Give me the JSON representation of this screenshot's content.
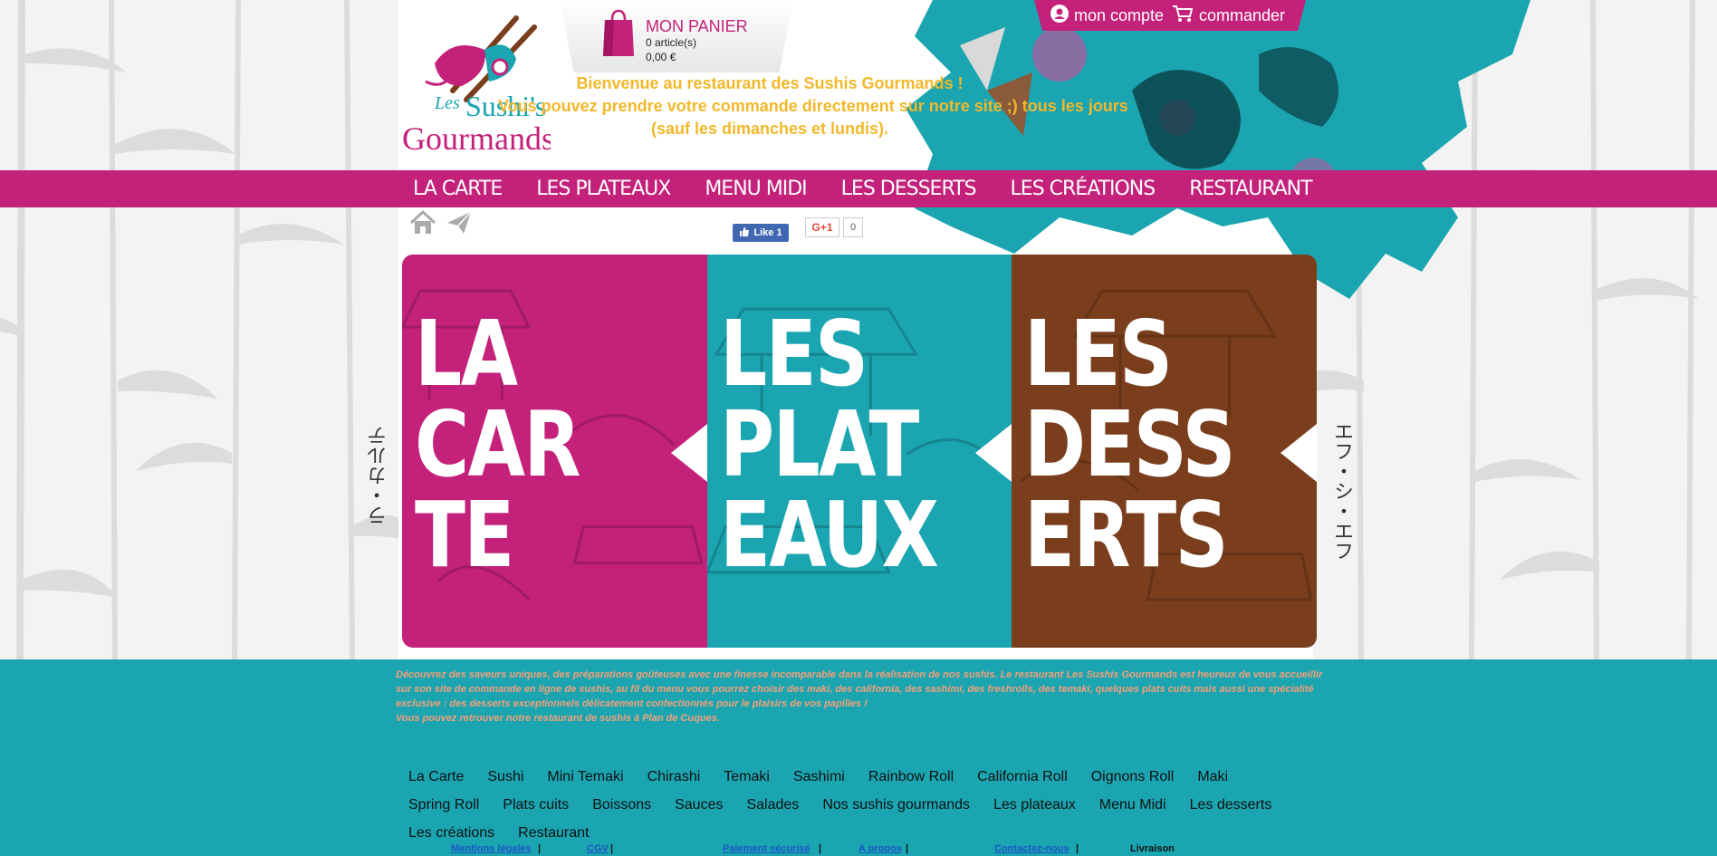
{
  "header": {
    "logo_text": "Les Sushi's Gourmands",
    "cart": {
      "title": "MON PANIER",
      "count": "0 article(s)",
      "total": "0,00 €"
    },
    "account": {
      "my_account": "mon compte",
      "order": "commander"
    },
    "welcome": {
      "line1": "Bienvenue au restaurant des Sushis Gourmands !",
      "line2": "Vous pouvez prendre votre commande directement sur notre site ;) tous les jours",
      "line3": "(sauf les dimanches et lundis)."
    }
  },
  "nav": {
    "items": [
      {
        "label": "La Carte"
      },
      {
        "label": "Les Plateaux"
      },
      {
        "label": "Menu Midi"
      },
      {
        "label": "Les Desserts"
      },
      {
        "label": "Les Créations"
      },
      {
        "label": "Restaurant"
      }
    ]
  },
  "social": {
    "like_label": "Like 1",
    "gplus_label": "G+1",
    "gplus_count": "0"
  },
  "banner": {
    "panels": [
      {
        "line1": "LA",
        "line2": "CAR",
        "line3": "TE",
        "color": "#c4217b"
      },
      {
        "line1": "LES",
        "line2": "PLAT",
        "line3": "EAUX",
        "color": "#1aa5b1"
      },
      {
        "line1": "LES",
        "line2": "DESS",
        "line3": "ERTS",
        "color": "#7a3e1d"
      }
    ],
    "side_left": "ラ・カルテ",
    "side_right": "エフ・シ・エフ"
  },
  "footer": {
    "intro": "Découvrez des saveurs uniques, des préparations goûteuses avec une finesse incomparable dans la réalisation de nos sushis. Le restaurant Les Sushis Gourmands est heureux de vous accueillir sur son site de commande en ligne de sushis, au fil du menu vous pourrez choisir des maki, des california, des sashimi, des freshrolls, des temaki, quelques plats cuits mais aussi une spécialité exclusive : des desserts exceptionnels délicatement confectionnés pour le plaisirs de vos papilles !",
    "intro2": "Vous pouvez retrouver notre restaurant de sushis à Plan de Cuques.",
    "links": [
      "La Carte",
      "Sushi",
      "Mini Temaki",
      "Chirashi",
      "Temaki",
      "Sashimi",
      "Rainbow Roll",
      "California Roll",
      "Oignons Roll",
      "Maki",
      "Spring Roll",
      "Plats cuits",
      "Boissons",
      "Sauces",
      "Salades",
      "Nos sushis gourmands",
      "Les plateaux",
      "Menu Midi",
      "Les desserts",
      "Les créations",
      "Restaurant"
    ],
    "legal": {
      "mentions": "Mentions légales",
      "cgv": "CGV",
      "paiement": "Paiement sécurisé",
      "apropos": "A propos",
      "contact": "Contactez-nous",
      "livraison": "Livraison"
    }
  },
  "colors": {
    "magenta": "#c4217b",
    "teal": "#1aa5b1",
    "brown": "#7a3e1d",
    "yellow": "#f3b82a"
  }
}
